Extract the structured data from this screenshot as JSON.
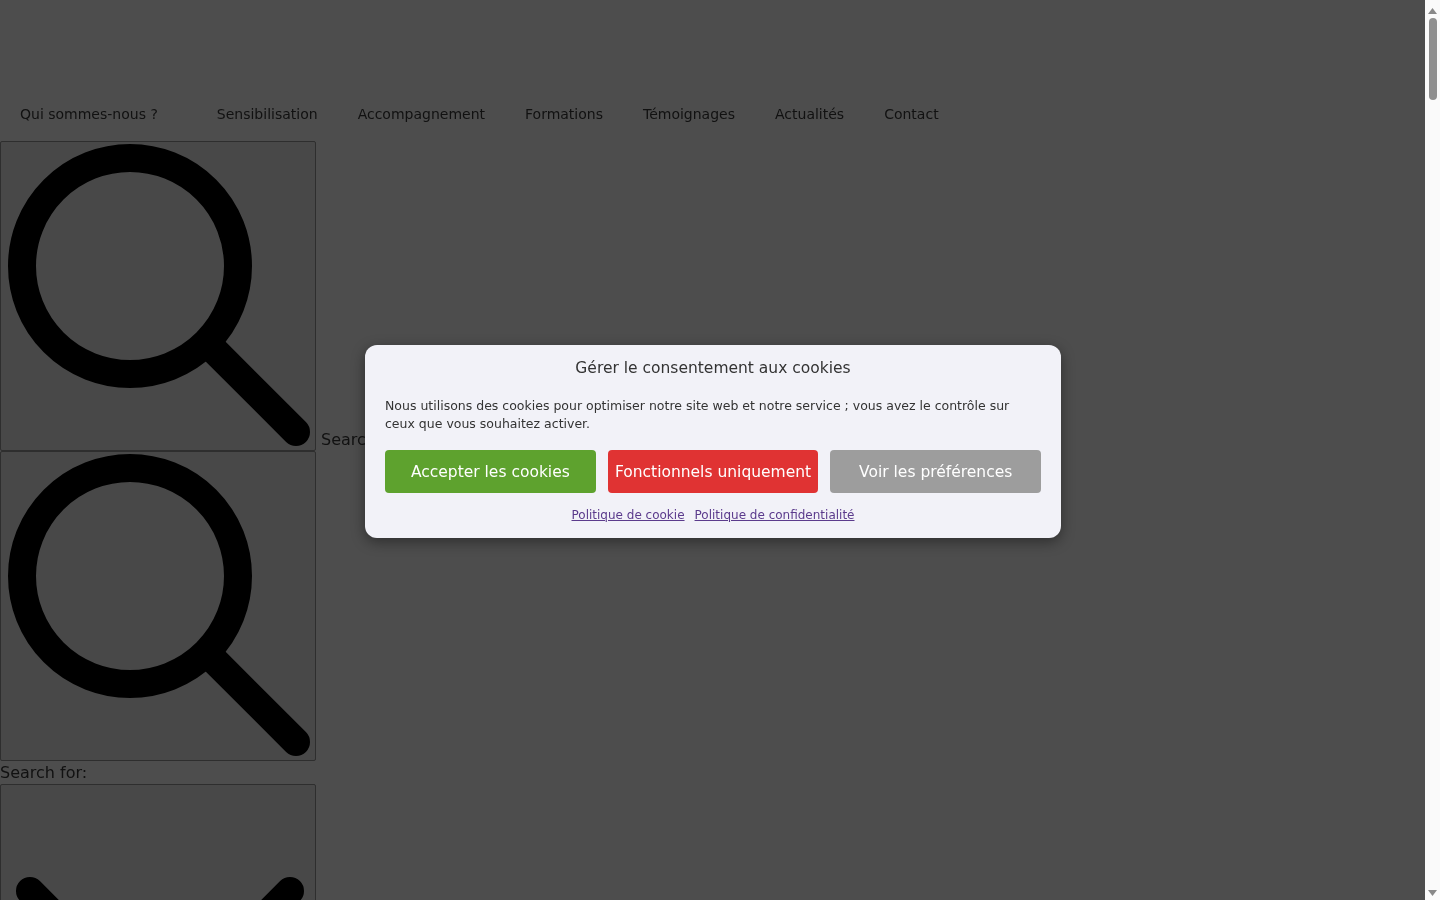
{
  "nav": {
    "items": [
      {
        "label": "Qui sommes-nous ?"
      },
      {
        "label": "Sensibilisation"
      },
      {
        "label": "Accompagnement"
      },
      {
        "label": "Formations"
      },
      {
        "label": "Témoignages"
      },
      {
        "label": "Actualités"
      },
      {
        "label": "Contact"
      }
    ]
  },
  "search": {
    "toggle_label": "Searc",
    "field_label": "Search for:"
  },
  "cookie_dialog": {
    "title": "Gérer le consentement aux cookies",
    "text": "Nous utilisons des cookies pour optimiser notre site web et notre service ; vous avez le contrôle sur ceux que vous souhaitez activer.",
    "buttons": [
      {
        "kind": "accept",
        "label": "Accepter les cookies"
      },
      {
        "kind": "deny",
        "label": "Fonctionnels uniquement"
      },
      {
        "kind": "preferences",
        "label": "Voir les préférences"
      }
    ],
    "links": [
      {
        "label": "Politique de cookie"
      },
      {
        "label": "Politique de confidentialité"
      }
    ]
  }
}
